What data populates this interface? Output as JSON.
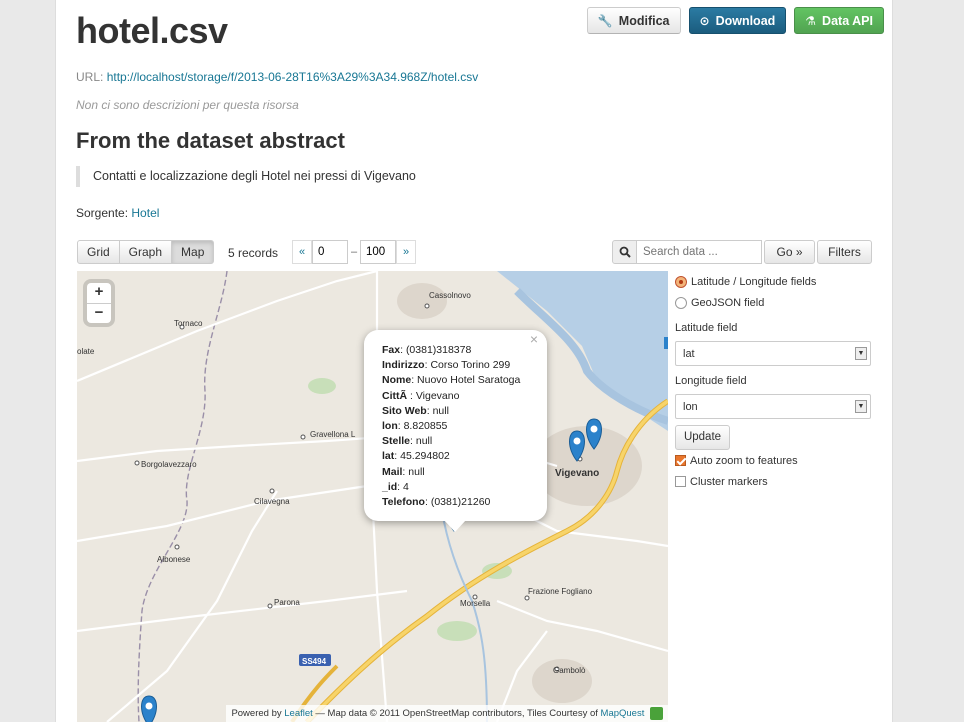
{
  "header": {
    "title": "hotel.csv",
    "edit_label": "Modifica",
    "download_label": "Download",
    "api_label": "Data API"
  },
  "resource": {
    "url_label": "URL:",
    "url": "http://localhost/storage/f/2013-06-28T16%3A29%3A34.968Z/hotel.csv",
    "no_description": "Non ci sono descrizioni per questa risorsa",
    "abstract_heading": "From the dataset abstract",
    "abstract_text": "Contatti e localizzazione degli Hotel nei pressi di Vigevano",
    "source_label": "Sorgente:",
    "source_link": "Hotel"
  },
  "toolbar": {
    "views": [
      "Grid",
      "Graph",
      "Map"
    ],
    "active_view": "Map",
    "records": "5 records",
    "prev": "«",
    "from": "0",
    "to": "100",
    "next": "»",
    "dash": "–",
    "search_placeholder": "Search data ...",
    "go_label": "Go »",
    "filters_label": "Filters"
  },
  "map": {
    "zoom_in": "+",
    "zoom_out": "−",
    "places": [
      "Cassolnovo",
      "Tornaco",
      "Gravellona L",
      "Borgolavezzaro",
      "Cilavegna",
      "Vigevano",
      "Albonese",
      "Parona",
      "Morsella",
      "Frazione Fogliano",
      "Gambolò",
      "olate",
      "SS494"
    ],
    "popup": {
      "close": "×",
      "fields": [
        {
          "key": "Fax",
          "value": "(0381)318378"
        },
        {
          "key": "Indirizzo",
          "value": "Corso Torino 299"
        },
        {
          "key": "Nome",
          "value": "Nuovo Hotel Saratoga"
        },
        {
          "key": "CittÃ ",
          "value": "Vigevano"
        },
        {
          "key": "Sito Web",
          "value": "null"
        },
        {
          "key": "lon",
          "value": "8.820855"
        },
        {
          "key": "Stelle",
          "value": "null"
        },
        {
          "key": "lat",
          "value": "45.294802"
        },
        {
          "key": "Mail",
          "value": "null"
        },
        {
          "key": "_id",
          "value": "4"
        },
        {
          "key": "Telefono",
          "value": "(0381)21260"
        }
      ]
    },
    "attribution": {
      "powered": "Powered by",
      "leaflet": "Leaflet",
      "rest": "— Map data © 2011 OpenStreetMap contributors, Tiles Courtesy of",
      "mapquest": "MapQuest"
    }
  },
  "sidebar": {
    "radio_latlon": "Latitude / Longitude fields",
    "radio_geojson": "GeoJSON field",
    "lat_label": "Latitude field",
    "lat_value": "lat",
    "lon_label": "Longitude field",
    "lon_value": "lon",
    "update_label": "Update",
    "auto_zoom": "Auto zoom to features",
    "cluster": "Cluster markers"
  },
  "colors": {
    "link": "#187794",
    "download_btn": "#1b5c7e",
    "api_btn": "#51a351",
    "marker": "#2b82cb",
    "road_major": "#f5c94a"
  }
}
